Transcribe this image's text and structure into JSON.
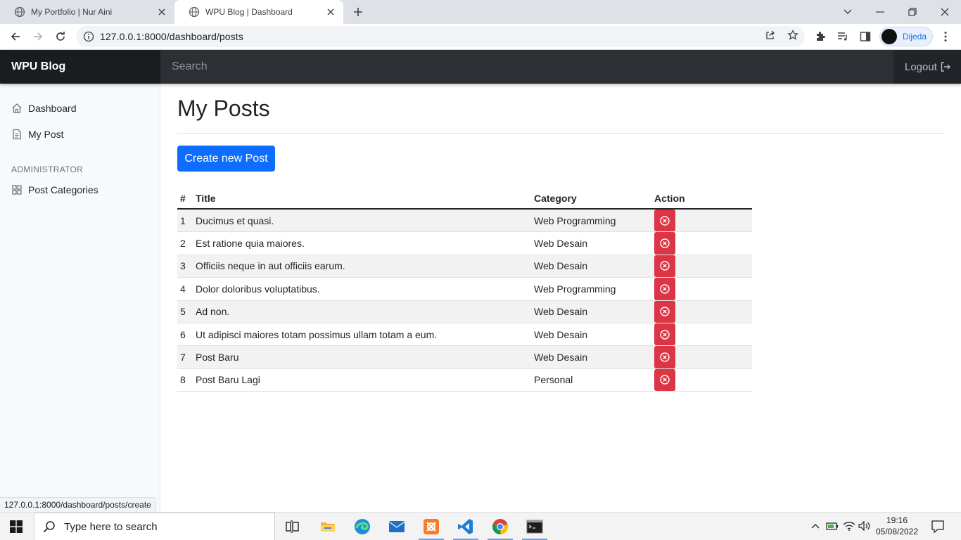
{
  "browser": {
    "tabs": [
      {
        "title": "My Portfolio | Nur Aini"
      },
      {
        "title": "WPU Blog | Dashboard"
      }
    ],
    "url": "127.0.0.1:8000/dashboard/posts",
    "profile_name": "Dijeda",
    "status_url": "127.0.0.1:8000/dashboard/posts/create"
  },
  "header": {
    "brand": "WPU Blog",
    "search_placeholder": "Search",
    "logout_label": "Logout"
  },
  "sidebar": {
    "items": [
      {
        "label": "Dashboard",
        "icon": "home-icon"
      },
      {
        "label": "My Post",
        "icon": "file-text-icon"
      }
    ],
    "admin_heading": "ADMINISTRATOR",
    "admin_items": [
      {
        "label": "Post Categories",
        "icon": "grid-icon"
      }
    ]
  },
  "main": {
    "title": "My Posts",
    "create_button": "Create new Post",
    "table": {
      "headers": [
        "#",
        "Title",
        "Category",
        "Action"
      ],
      "rows": [
        {
          "num": "1",
          "title": "Ducimus et quasi.",
          "category": "Web Programming"
        },
        {
          "num": "2",
          "title": "Est ratione quia maiores.",
          "category": "Web Desain"
        },
        {
          "num": "3",
          "title": "Officiis neque in aut officiis earum.",
          "category": "Web Desain"
        },
        {
          "num": "4",
          "title": "Dolor doloribus voluptatibus.",
          "category": "Web Programming"
        },
        {
          "num": "5",
          "title": "Ad non.",
          "category": "Web Desain"
        },
        {
          "num": "6",
          "title": "Ut adipisci maiores totam possimus ullam totam a eum.",
          "category": "Web Desain"
        },
        {
          "num": "7",
          "title": "Post Baru",
          "category": "Web Desain"
        },
        {
          "num": "8",
          "title": "Post Baru Lagi",
          "category": "Personal"
        }
      ]
    }
  },
  "taskbar": {
    "search_placeholder": "Type here to search",
    "time": "19:16",
    "date": "05/08/2022"
  },
  "colors": {
    "primary": "#0d6efd",
    "info": "#0dcaf0",
    "warning": "#ffc107",
    "danger": "#dc3545",
    "dark": "#212529"
  }
}
